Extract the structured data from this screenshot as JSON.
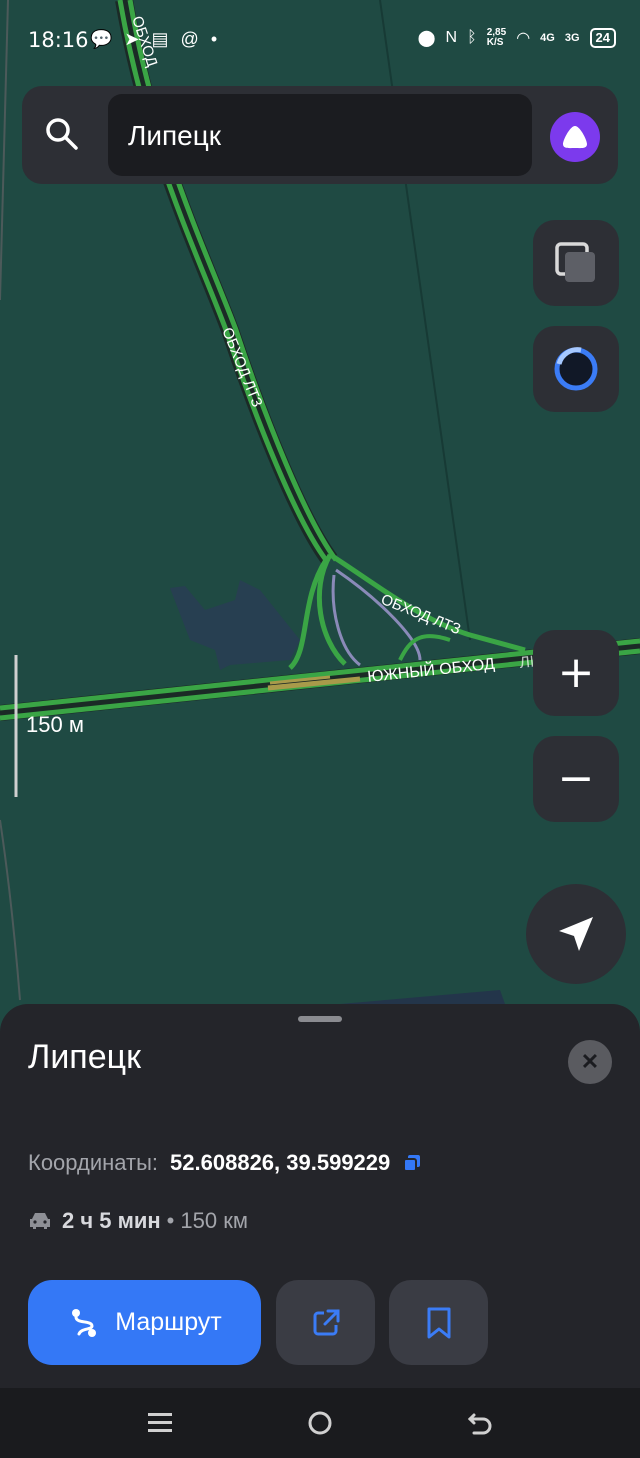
{
  "status_bar": {
    "time": "18:16",
    "network_speed_value": "2,85",
    "network_speed_unit": "K/S",
    "signal_1": "4G",
    "signal_2": "3G",
    "battery": "24"
  },
  "search": {
    "query": "Липецк",
    "search_icon": "search-icon",
    "assistant_icon": "alice-icon"
  },
  "map": {
    "road_labels": [
      "ОБХОД",
      "ОБХОД ЛТЗ",
      "ОБХОД ЛТЗ",
      "ЮЖНЫЙ ОБХОД",
      "ЛИПЕЦКА"
    ],
    "scale": "150 м",
    "colors": {
      "background": "#1f4a43",
      "road": "#3aa545",
      "road_slow": "#a89a4a",
      "ramp": "#8a8ab8"
    }
  },
  "controls": {
    "layers": "layers-icon",
    "alice_map": "alice-ring-icon",
    "zoom_in": "+",
    "zoom_out": "−",
    "locate": "navigation-arrow-icon"
  },
  "sheet": {
    "title": "Липецк",
    "coords_label": "Координаты:",
    "coords_value": "52.608826, 39.599229",
    "duration": "2 ч 5 мин",
    "separator": "•",
    "distance": "150 км",
    "route_button": "Маршрут",
    "accent": "#3478f6"
  }
}
